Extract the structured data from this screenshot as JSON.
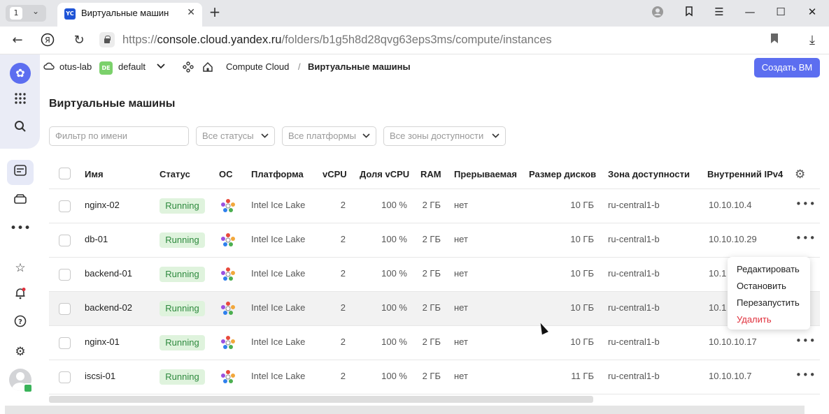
{
  "browser": {
    "tab_count": "1",
    "tab_favicon": "YC",
    "tab_title": "Виртуальные машин",
    "url_prefix": "https://",
    "url_host": "console.cloud.yandex.ru",
    "url_path": "/folders/b1g5h8d28qvg63eps3ms/compute/instances"
  },
  "header": {
    "cloud": "otus-lab",
    "folder_badge": "DE",
    "folder": "default",
    "service": "Compute Cloud",
    "separator": "/",
    "page": "Виртуальные машины",
    "create_button": "Создать ВМ"
  },
  "page_title": "Виртуальные машины",
  "filters": {
    "name_placeholder": "Фильтр по имени",
    "status": "Все статусы",
    "platform": "Все платформы",
    "zone": "Все зоны доступности"
  },
  "table": {
    "columns": [
      "Имя",
      "Статус",
      "ОС",
      "Платформа",
      "vCPU",
      "Доля vCPU",
      "RAM",
      "Прерываемая",
      "Размер дисков",
      "Зона доступности",
      "Внутренний IPv4"
    ],
    "rows": [
      {
        "name": "nginx-02",
        "status": "Running",
        "platform": "Intel Ice Lake",
        "vcpu": "2",
        "share": "100 %",
        "ram": "2 ГБ",
        "preempt": "нет",
        "disk": "10 ГБ",
        "zone": "ru-central1-b",
        "ip": "10.10.10.4"
      },
      {
        "name": "db-01",
        "status": "Running",
        "platform": "Intel Ice Lake",
        "vcpu": "2",
        "share": "100 %",
        "ram": "2 ГБ",
        "preempt": "нет",
        "disk": "10 ГБ",
        "zone": "ru-central1-b",
        "ip": "10.10.10.29"
      },
      {
        "name": "backend-01",
        "status": "Running",
        "platform": "Intel Ice Lake",
        "vcpu": "2",
        "share": "100 %",
        "ram": "2 ГБ",
        "preempt": "нет",
        "disk": "10 ГБ",
        "zone": "ru-central1-b",
        "ip": "10.1"
      },
      {
        "name": "backend-02",
        "status": "Running",
        "platform": "Intel Ice Lake",
        "vcpu": "2",
        "share": "100 %",
        "ram": "2 ГБ",
        "preempt": "нет",
        "disk": "10 ГБ",
        "zone": "ru-central1-b",
        "ip": "10.1"
      },
      {
        "name": "nginx-01",
        "status": "Running",
        "platform": "Intel Ice Lake",
        "vcpu": "2",
        "share": "100 %",
        "ram": "2 ГБ",
        "preempt": "нет",
        "disk": "10 ГБ",
        "zone": "ru-central1-b",
        "ip": "10.10.10.17"
      },
      {
        "name": "iscsi-01",
        "status": "Running",
        "platform": "Intel Ice Lake",
        "vcpu": "2",
        "share": "100 %",
        "ram": "2 ГБ",
        "preempt": "нет",
        "disk": "11 ГБ",
        "zone": "ru-central1-b",
        "ip": "10.10.10.7"
      }
    ]
  },
  "context_menu": {
    "edit": "Редактировать",
    "stop": "Остановить",
    "restart": "Перезапустить",
    "delete": "Удалить"
  },
  "colors": {
    "accent": "#5c6ef0",
    "running_bg": "#dff3dd",
    "running_text": "#2e8a3e",
    "danger": "#e0303c"
  }
}
